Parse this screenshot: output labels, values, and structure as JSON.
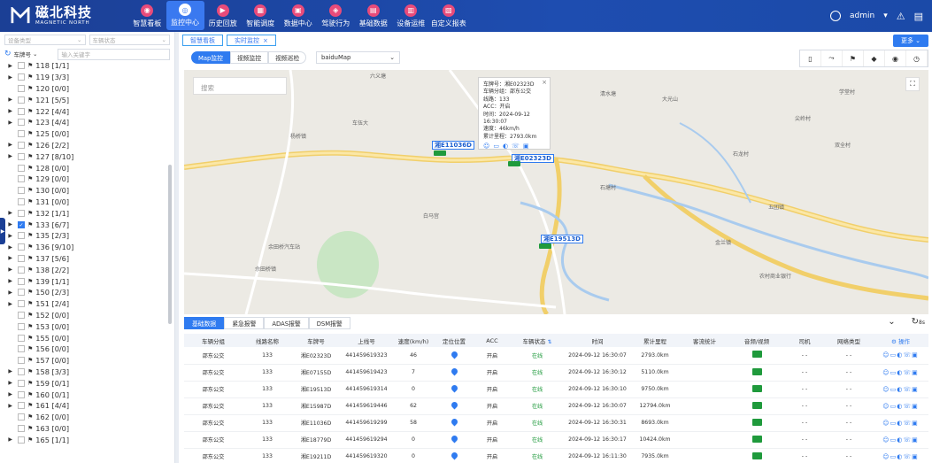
{
  "brand": {
    "name_cn": "磁北科技",
    "name_en": "MAGNETIC NORTH"
  },
  "nav": [
    {
      "label": "智慧看板",
      "icon": "dashboard-icon",
      "glyph": "◉"
    },
    {
      "label": "监控中心",
      "icon": "monitor-icon",
      "glyph": "◎",
      "active": true
    },
    {
      "label": "历史回放",
      "icon": "replay-icon",
      "glyph": "▶"
    },
    {
      "label": "智能调度",
      "icon": "dispatch-icon",
      "glyph": "▦"
    },
    {
      "label": "数据中心",
      "icon": "data-icon",
      "glyph": "▣"
    },
    {
      "label": "驾驶行为",
      "icon": "driving-icon",
      "glyph": "◈"
    },
    {
      "label": "基础数据",
      "icon": "base-data-icon",
      "glyph": "▤"
    },
    {
      "label": "设备运维",
      "icon": "device-icon",
      "glyph": "▥"
    },
    {
      "label": "自定义报表",
      "icon": "report-icon",
      "glyph": "▧"
    }
  ],
  "user": {
    "name": "admin",
    "caret": "▾"
  },
  "sidebar": {
    "device_type_placeholder": "设备类型",
    "vehicle_status_placeholder": "车辆状态",
    "search_field": "车牌号",
    "search_placeholder": "输入关键字",
    "tree": [
      {
        "label": "118 [1/1]",
        "expand": true
      },
      {
        "label": "119 [3/3]",
        "expand": true
      },
      {
        "label": "120 [0/0]",
        "expand": false
      },
      {
        "label": "121 [5/5]",
        "expand": true
      },
      {
        "label": "122 [4/4]",
        "expand": true
      },
      {
        "label": "123 [4/4]",
        "expand": true
      },
      {
        "label": "125 [0/0]",
        "expand": false
      },
      {
        "label": "126 [2/2]",
        "expand": true
      },
      {
        "label": "127 [8/10]",
        "expand": true
      },
      {
        "label": "128 [0/0]",
        "expand": false
      },
      {
        "label": "129 [0/0]",
        "expand": false
      },
      {
        "label": "130 [0/0]",
        "expand": false
      },
      {
        "label": "131 [0/0]",
        "expand": false
      },
      {
        "label": "132 [1/1]",
        "expand": true
      },
      {
        "label": "133 [6/7]",
        "expand": true,
        "checked": true
      },
      {
        "label": "135 [2/3]",
        "expand": true
      },
      {
        "label": "136 [9/10]",
        "expand": true
      },
      {
        "label": "137 [5/6]",
        "expand": true
      },
      {
        "label": "138 [2/2]",
        "expand": true
      },
      {
        "label": "139 [1/1]",
        "expand": true
      },
      {
        "label": "150 [2/3]",
        "expand": true
      },
      {
        "label": "151 [2/4]",
        "expand": true
      },
      {
        "label": "152 [0/0]",
        "expand": false
      },
      {
        "label": "153 [0/0]",
        "expand": false
      },
      {
        "label": "155 [0/0]",
        "expand": false
      },
      {
        "label": "156 [0/0]",
        "expand": false
      },
      {
        "label": "157 [0/0]",
        "expand": false
      },
      {
        "label": "158 [3/3]",
        "expand": true
      },
      {
        "label": "159 [0/1]",
        "expand": true
      },
      {
        "label": "160 [0/1]",
        "expand": true
      },
      {
        "label": "161 [4/4]",
        "expand": true
      },
      {
        "label": "162 [0/0]",
        "expand": false
      },
      {
        "label": "163 [0/0]",
        "expand": false
      },
      {
        "label": "165 [1/1]",
        "expand": true
      }
    ]
  },
  "tabs": [
    {
      "label": "智慧看板",
      "closable": false
    },
    {
      "label": "实时监控",
      "closable": true
    }
  ],
  "more_label": "更多",
  "subtabs": [
    "Map监控",
    "视频监控",
    "视频巡检"
  ],
  "map_provider": "baiduMap",
  "map": {
    "search_placeholder": "搜索",
    "popup": {
      "lines": [
        "车牌号：湘E02323D",
        "车辆分组：邵东公交",
        "线路：133",
        "ACC：开启",
        "时间：2024-09-12 16:30:07",
        "速度：46km/h",
        "累计里程：2793.0km"
      ]
    },
    "vehicles": [
      "湘E11036D",
      "湘E02323D",
      "湘E19513D"
    ],
    "places": [
      "杨桥镇",
      "大光山",
      "石塘村",
      "金兰镇",
      "佘田桥镇",
      "农村商业银行",
      "余田桥汽车站",
      "六义塘",
      "清水塘",
      "车伍大",
      "五团镇",
      "尖岭村",
      "双全村",
      "白马宫",
      "石龙村",
      "学堂村"
    ]
  },
  "table_tabs": [
    "基础数据",
    "紧急报警",
    "ADAS报警",
    "DSM报警"
  ],
  "refresh": {
    "label": "8s"
  },
  "table": {
    "headers": [
      "车辆分组",
      "线路名称",
      "车牌号",
      "上线号",
      "速度(km/h)",
      "定位位置",
      "ACC",
      "车辆状态",
      "时间",
      "累计里程",
      "客流统计",
      "音频/视频",
      "司机",
      "网络类型",
      "操作"
    ],
    "rows": [
      [
        "邵东公交",
        "133",
        "湘E02323D",
        "441459619323",
        "46",
        "",
        "开启",
        "在线",
        "2024-09-12 16:30:07",
        "2793.0km",
        "",
        "",
        "- -",
        "- -",
        ""
      ],
      [
        "邵东公交",
        "133",
        "湘E07155D",
        "441459619423",
        "7",
        "",
        "开启",
        "在线",
        "2024-09-12 16:30:12",
        "5110.0km",
        "",
        "",
        "- -",
        "- -",
        ""
      ],
      [
        "邵东公交",
        "133",
        "湘E19513D",
        "441459619314",
        "0",
        "",
        "开启",
        "在线",
        "2024-09-12 16:30:10",
        "9750.0km",
        "",
        "",
        "- -",
        "- -",
        ""
      ],
      [
        "邵东公交",
        "133",
        "湘E15987D",
        "441459619446",
        "62",
        "",
        "开启",
        "在线",
        "2024-09-12 16:30:07",
        "12794.0km",
        "",
        "",
        "- -",
        "- -",
        ""
      ],
      [
        "邵东公交",
        "133",
        "湘E11036D",
        "441459619299",
        "58",
        "",
        "开启",
        "在线",
        "2024-09-12 16:30:31",
        "8693.0km",
        "",
        "",
        "- -",
        "- -",
        ""
      ],
      [
        "邵东公交",
        "133",
        "湘E18779D",
        "441459619294",
        "0",
        "",
        "开启",
        "在线",
        "2024-09-12 16:30:17",
        "10424.0km",
        "",
        "",
        "- -",
        "- -",
        ""
      ],
      [
        "邵东公交",
        "133",
        "湘E19211D",
        "441459619320",
        "0",
        "",
        "开启",
        "在线",
        "2024-09-12 16:11:30",
        "7935.0km",
        "",
        "",
        "- -",
        "- -",
        ""
      ]
    ],
    "op_label": "操作"
  }
}
